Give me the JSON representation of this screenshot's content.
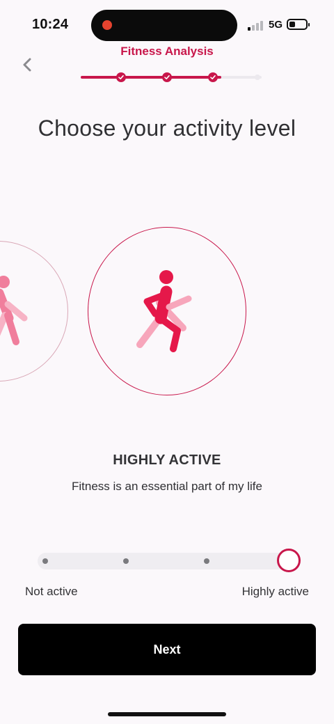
{
  "status_bar": {
    "time": "10:24",
    "network": "5G",
    "battery_level": 0.35,
    "signal_bars_active": 1,
    "icons": [
      "recording-indicator-icon",
      "signal-icon",
      "battery-icon"
    ]
  },
  "header": {
    "title": "Fitness Analysis",
    "back_icon": "chevron-left-icon",
    "progress": {
      "total_steps": 4,
      "completed_steps": 3
    }
  },
  "page": {
    "title": "Choose your activity level"
  },
  "activity": {
    "selected_icon": "running-person-icon",
    "previous_icon": "walking-person-icon",
    "level_title": "HIGHLY ACTIVE",
    "level_description": "Fitness is an essential part of my life"
  },
  "slider": {
    "min_label": "Not active",
    "max_label": "Highly active",
    "levels": 4,
    "selected_index": 3
  },
  "actions": {
    "next_label": "Next"
  },
  "colors": {
    "accent": "#c8174b",
    "accent_light": "#f0688f",
    "background": "#fbf8fb",
    "button": "#000000"
  }
}
